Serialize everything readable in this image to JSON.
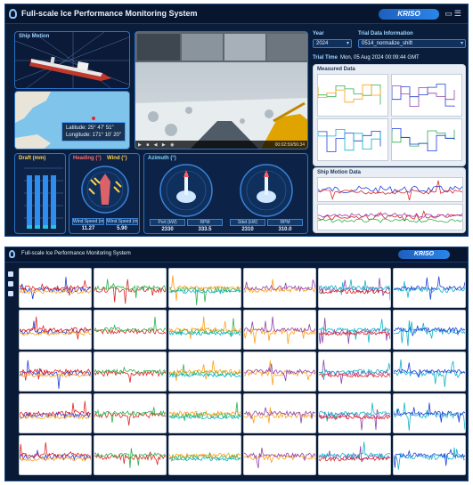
{
  "app": {
    "title": "Full-scale Ice Performance Monitoring System",
    "brand": "KRISO",
    "brand_color": "#2a86e8",
    "top_icons": [
      "window-icon",
      "menu-icon"
    ]
  },
  "ship_motion": {
    "title": "Ship Motion"
  },
  "map": {
    "latitude": "Latitude: 25° 47' 51\"",
    "longitude": "Longitude: 171° 10' 20\""
  },
  "video": {
    "timestamp": "00:02:59/56:34"
  },
  "selectors": {
    "year_label": "Year",
    "year_value": "2024",
    "trial_label": "Trial Data Information",
    "trial_value": "0514_normalize_shift",
    "trial_time_label": "Trial Time",
    "trial_time_value": "Mon, 05 Aug 2024 00:09:44 GMT"
  },
  "measured": {
    "title": "Measured Data"
  },
  "ship_data": {
    "title": "Ship Motion Data"
  },
  "draft": {
    "title": "Draft (mm)"
  },
  "heading": {
    "heading_label": "Heading (°)",
    "wind_label": "Wind (°)",
    "readouts": [
      {
        "label": "Wind Speed (m/s)",
        "value": "11.27"
      },
      {
        "label": "Wind Speed (m/s)",
        "value": "5.90"
      }
    ]
  },
  "azimuth": {
    "title": "Azimuth (°)",
    "readouts": [
      {
        "label": "Port (kW)",
        "value": "2330"
      },
      {
        "label": "RPM",
        "value": "333.5"
      },
      {
        "label": "Stbd (kW)",
        "value": "2310"
      },
      {
        "label": "RPM",
        "value": "310.0"
      }
    ]
  },
  "screen2": {
    "title": "Full-scale Ice Performance Monitoring System",
    "brand": "KRISO"
  },
  "colors": {
    "background": "#0a1e3c",
    "accent": "#2a72c8",
    "series": [
      "#1f3fd9",
      "#e02424",
      "#2bb24c",
      "#ff9f1c",
      "#8e44ad",
      "#10b4c8"
    ]
  }
}
